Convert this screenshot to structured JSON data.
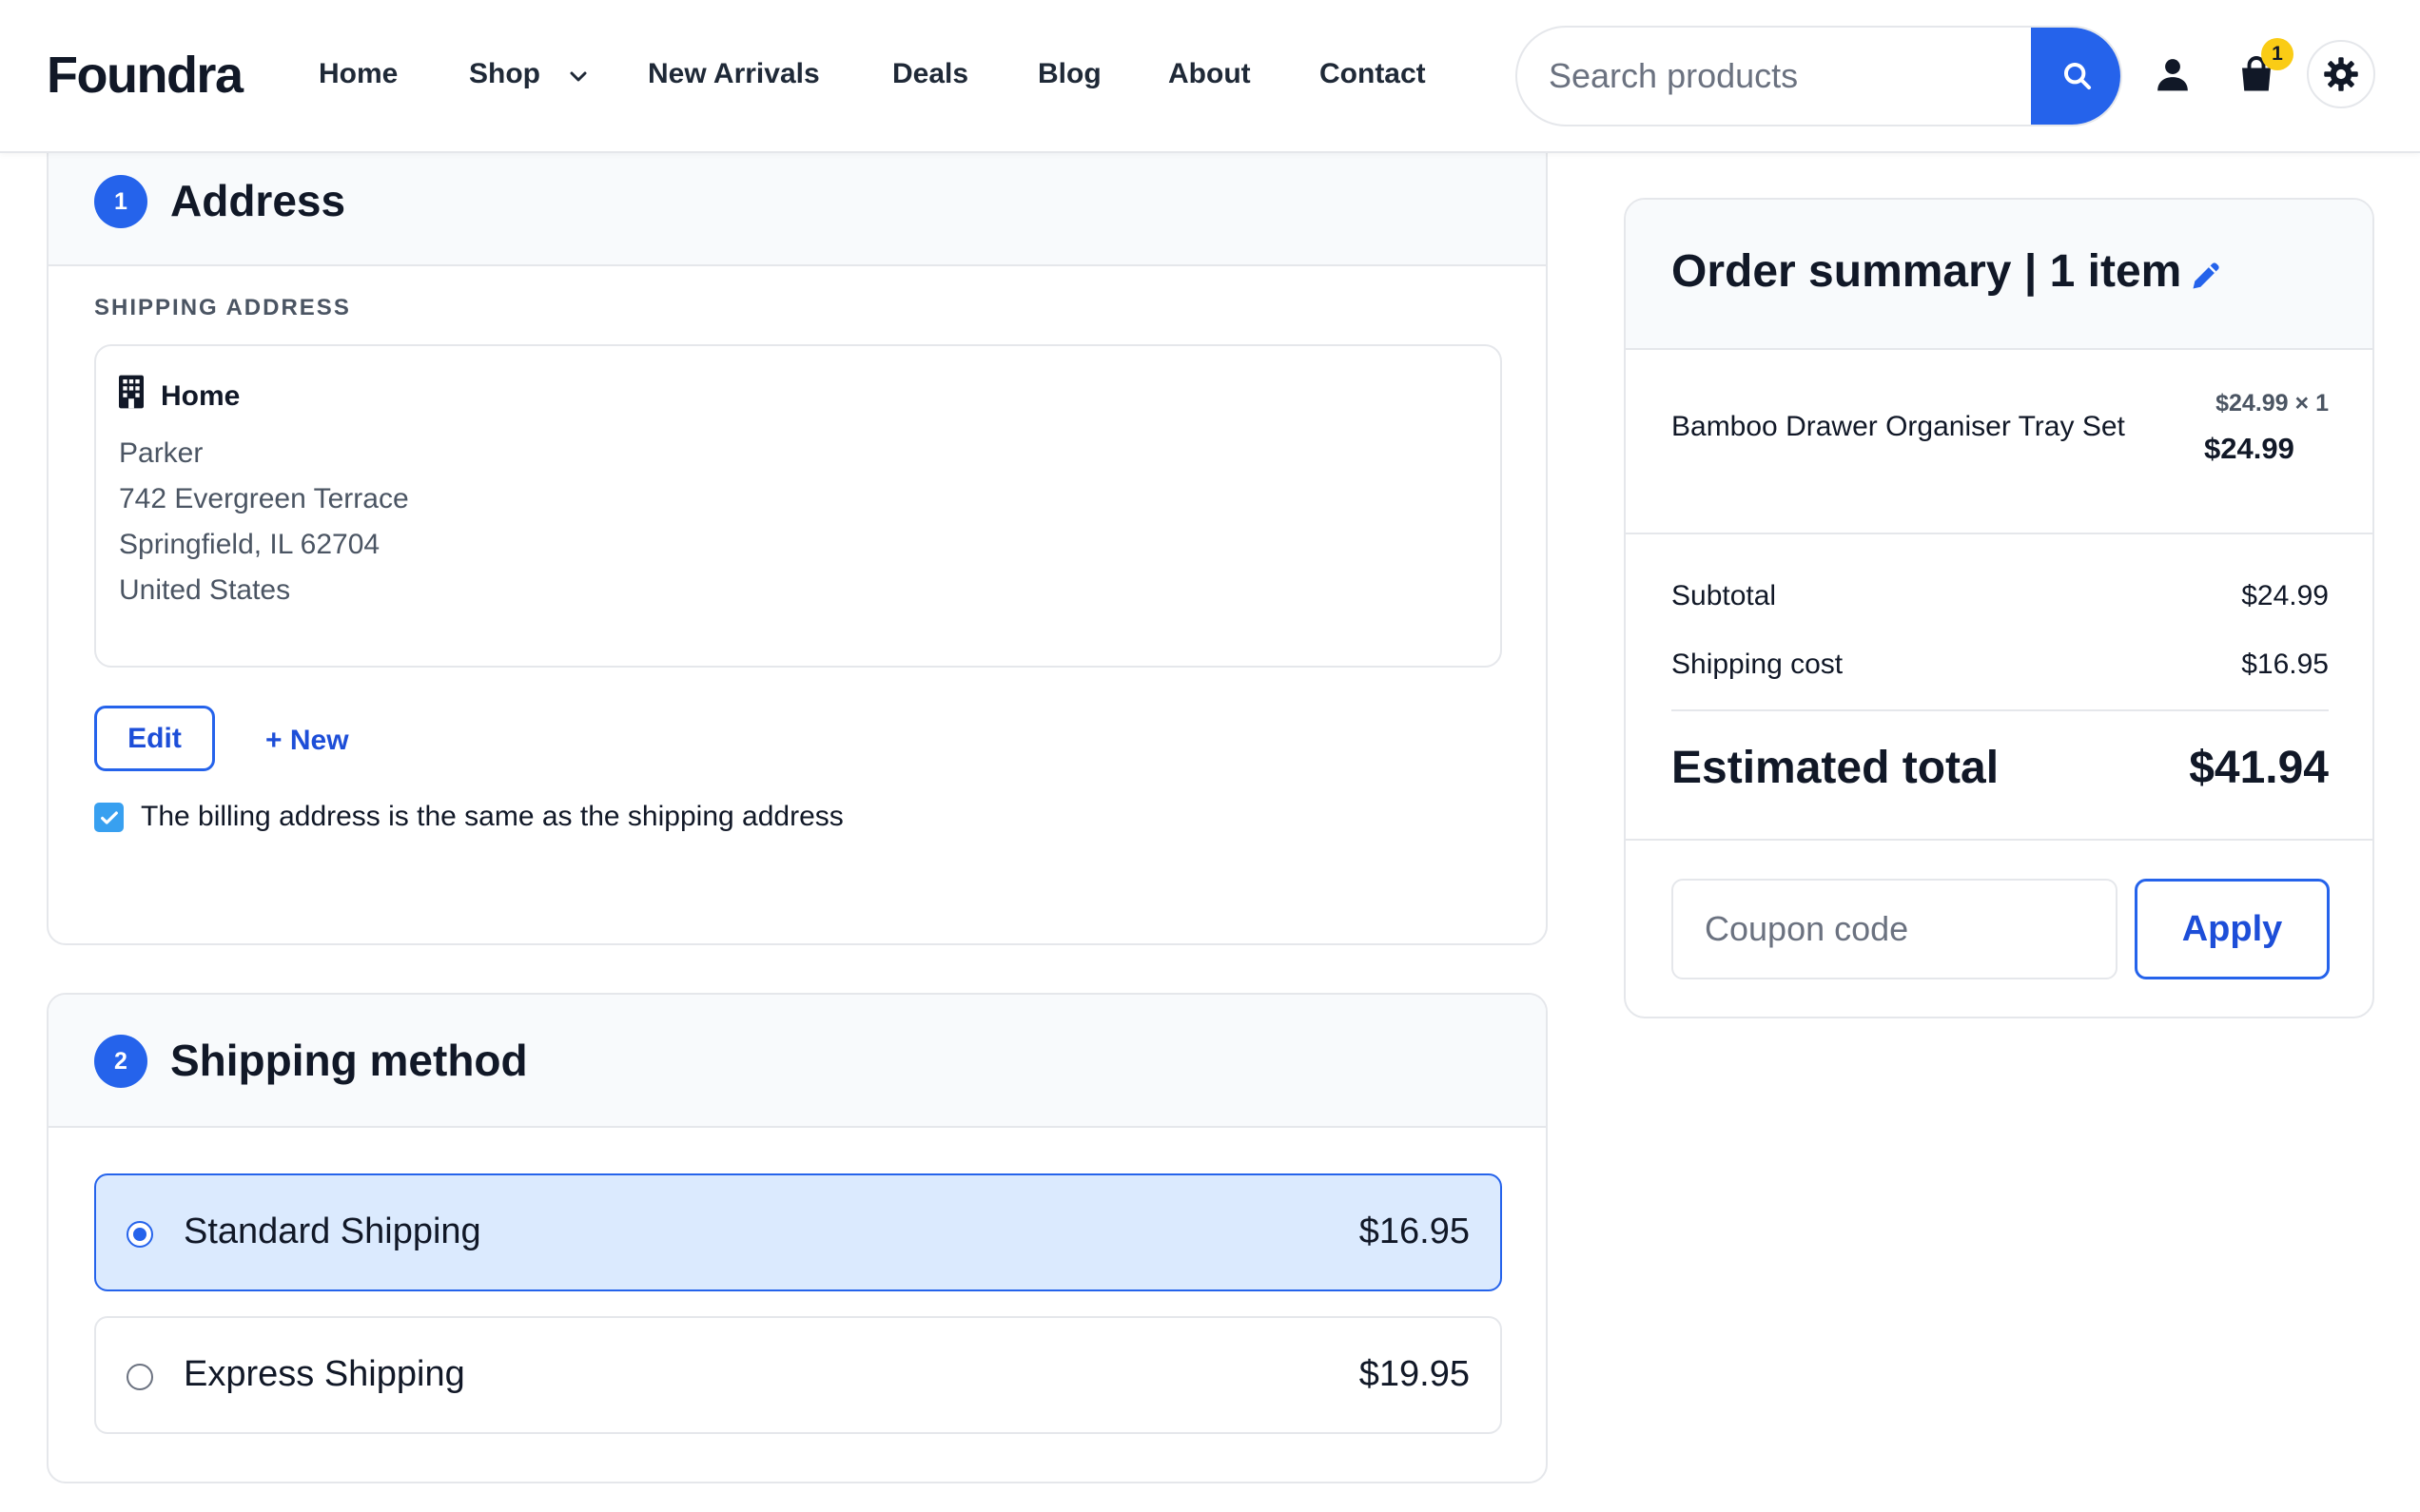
{
  "header": {
    "logo": "Foundra",
    "nav": [
      {
        "label": "Home"
      },
      {
        "label": "Shop"
      },
      {
        "label": "New Arrivals"
      },
      {
        "label": "Deals"
      },
      {
        "label": "Blog"
      },
      {
        "label": "About"
      },
      {
        "label": "Contact"
      }
    ],
    "search_placeholder": "Search products",
    "cart_count": "1",
    "icons": [
      "search-icon",
      "user-icon",
      "shopping-bag-icon",
      "gear-icon",
      "chevron-down-icon"
    ]
  },
  "address": {
    "step": "1",
    "title": "Address",
    "section_label": "SHIPPING ADDRESS",
    "entry": {
      "name": "Home",
      "lines": [
        "Parker",
        "742 Evergreen Terrace",
        "Springfield, IL 62704",
        "United States"
      ]
    },
    "edit_label": "Edit",
    "new_label": "+ New",
    "billing_same_label": "The billing address is the same as the shipping address",
    "billing_same_checked": true
  },
  "shipping": {
    "step": "2",
    "title": "Shipping method",
    "options": [
      {
        "name": "Standard Shipping",
        "price": "$16.95",
        "selected": true
      },
      {
        "name": "Express Shipping",
        "price": "$19.95",
        "selected": false
      }
    ]
  },
  "summary": {
    "title": "Order summary | 1 item",
    "item": {
      "name": "Bamboo Drawer Organiser Tray Set",
      "unit": "$24.99 × 1",
      "total": "$24.99"
    },
    "subtotal_label": "Subtotal",
    "subtotal_value": "$24.99",
    "shipping_label": "Shipping cost",
    "shipping_value": "$16.95",
    "total_label": "Estimated total",
    "total_value": "$41.94",
    "coupon_placeholder": "Coupon code",
    "apply_label": "Apply"
  },
  "colors": {
    "accent": "#2563eb",
    "selected_bg": "#dbeafe",
    "badge": "#facc15",
    "checkbox": "#38a0f0"
  }
}
